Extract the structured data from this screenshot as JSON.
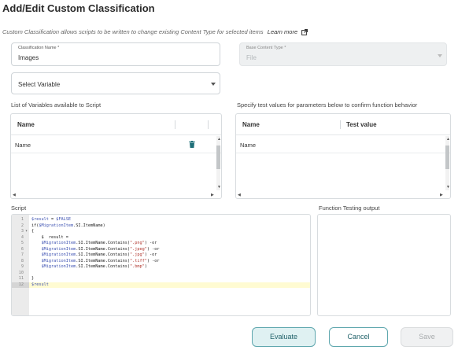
{
  "dialog": {
    "title": "Add/Edit Custom Classification",
    "subtitle": "Custom Classification allows scripts to be written to change existing Content Type for selected items",
    "learn_more": "Learn more"
  },
  "classification_name": {
    "label": "Classification Name *",
    "value": "Images"
  },
  "base_content_type": {
    "label": "Base Content Type *",
    "value": "File",
    "disabled": true
  },
  "select_variable": {
    "value": "Select Variable"
  },
  "variables_section": {
    "label": "List of Variables available to Script",
    "columns": [
      "Name"
    ],
    "rows": [
      {
        "name": "Name"
      }
    ]
  },
  "test_values_section": {
    "label": "Specify test values for parameters below to confirm function behavior",
    "columns": [
      "Name",
      "Test value"
    ],
    "rows": [
      {
        "name": "Name",
        "test_value": ""
      }
    ]
  },
  "script": {
    "label": "Script",
    "lines": [
      {
        "n": "1",
        "fold": "",
        "text": "$result = $FALSE"
      },
      {
        "n": "2",
        "fold": "",
        "text": "if($MigrationItem.SI.ItemName)"
      },
      {
        "n": "3",
        "fold": "▾",
        "text": "{"
      },
      {
        "n": "4",
        "fold": "",
        "text": "    $  result ="
      },
      {
        "n": "5",
        "fold": "",
        "text": "    $MigrationItem.SI.ItemName.Contains(\".png\") -or"
      },
      {
        "n": "6",
        "fold": "",
        "text": "    $MigrationItem.SI.ItemName.Contains(\".jpeg\") -or"
      },
      {
        "n": "7",
        "fold": "",
        "text": "    $MigrationItem.SI.ItemName.Contains(\".jpg\") -or"
      },
      {
        "n": "8",
        "fold": "",
        "text": "    $MigrationItem.SI.ItemName.Contains(\".tiff\") -or"
      },
      {
        "n": "9",
        "fold": "",
        "text": "    $MigrationItem.SI.ItemName.Contains(\".bmp\")"
      },
      {
        "n": "10",
        "fold": "",
        "text": ""
      },
      {
        "n": "11",
        "fold": "",
        "text": "}"
      },
      {
        "n": "12",
        "fold": "",
        "text": "$result",
        "active": true
      }
    ]
  },
  "output": {
    "label": "Function Testing output",
    "value": ""
  },
  "buttons": {
    "evaluate": "Evaluate",
    "cancel": "Cancel",
    "save": "Save"
  },
  "colors": {
    "accent": "#5fa7ae",
    "accent_text": "#21626a",
    "delete_icon": "#1e6f78",
    "active_line": "#fffbd2"
  }
}
